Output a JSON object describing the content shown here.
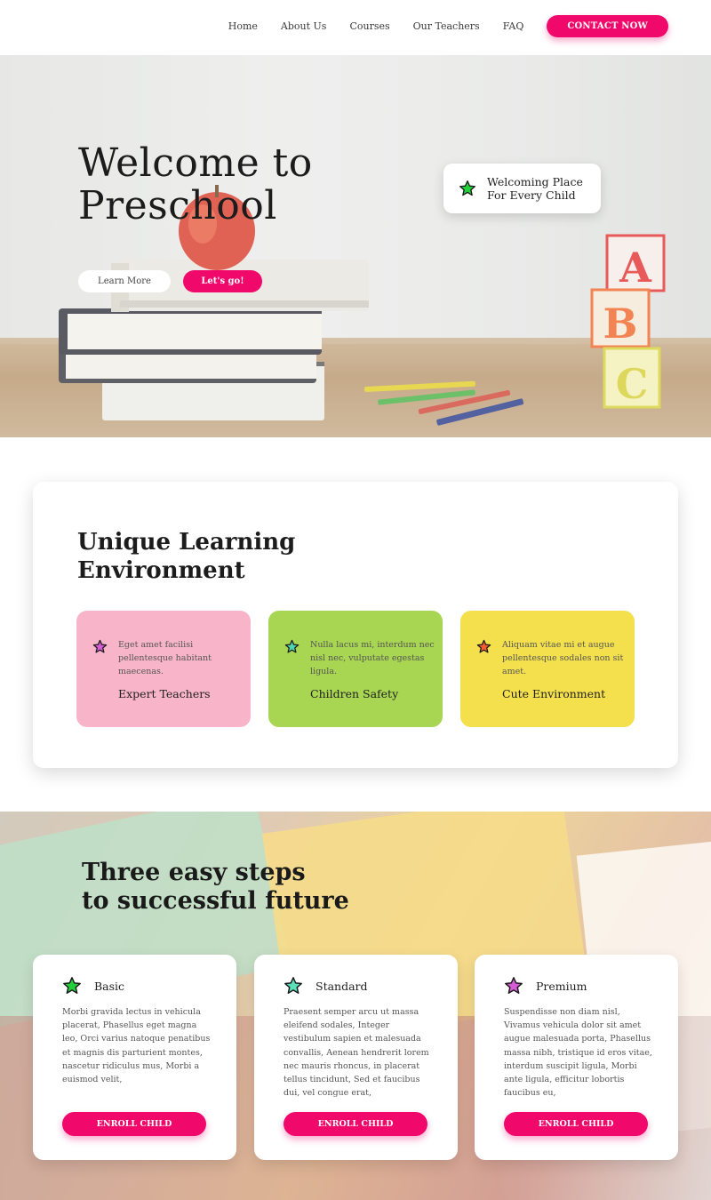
{
  "nav": {
    "links": [
      "Home",
      "About Us",
      "Courses",
      "Our Teachers",
      "FAQ"
    ],
    "contact_label": "CONTACT NOW"
  },
  "hero": {
    "title_line1": "Welcome to",
    "title_line2": "Preschool",
    "learn_more_label": "Learn More",
    "lets_go_label": "Let's go!",
    "badge_line1": "Welcoming Place",
    "badge_line2": "For Every Child",
    "badge_icon": "star-icon"
  },
  "learning": {
    "title_line1": "Unique Learning",
    "title_line2": "Environment",
    "features": [
      {
        "text": "Eget amet facilisi pellentesque habitant maecenas.",
        "title": "Expert Teachers",
        "bg": "#f8b4c8",
        "star": "#d65cd6"
      },
      {
        "text": "Nulla lacus mi, interdum nec nisl nec, vulputate egestas ligula.",
        "title": "Children Safety",
        "bg": "#a8d552",
        "star": "#4fd6b0"
      },
      {
        "text": "Aliquam vitae mi et augue pellentesque sodales non sit amet.",
        "title": "Cute Environment",
        "bg": "#f4e04d",
        "star": "#f25c2e"
      }
    ]
  },
  "steps": {
    "title_line1": "Three easy steps",
    "title_line2": "to successful future",
    "plans": [
      {
        "name": "Basic",
        "star": "#22d13a",
        "text": "Morbi gravida lectus in vehicula placerat, Phasellus eget magna leo, Orci varius natoque penatibus et magnis dis parturient montes, nascetur ridiculus mus, Morbi a euismod velit,",
        "button": "ENROLL CHILD"
      },
      {
        "name": "Standard",
        "star": "#5ce0b8",
        "text": "Praesent semper arcu ut massa eleifend sodales, Integer vestibulum sapien et malesuada convallis, Aenean hendrerit lorem nec mauris rhoncus, in placerat tellus tincidunt, Sed et faucibus dui, vel congue erat,",
        "button": "ENROLL CHILD"
      },
      {
        "name": "Premium",
        "star": "#d65cd6",
        "text": "Suspendisse non diam nisl, Vivamus vehicula dolor sit amet augue malesuada porta, Phasellus massa nibh, tristique id eros vitae, interdum suscipit ligula, Morbi ante ligula, efficitur lobortis faucibus eu,",
        "button": "ENROLL CHILD"
      }
    ]
  },
  "colors": {
    "accent": "#f0086a",
    "badge_star": "#22d13a"
  }
}
